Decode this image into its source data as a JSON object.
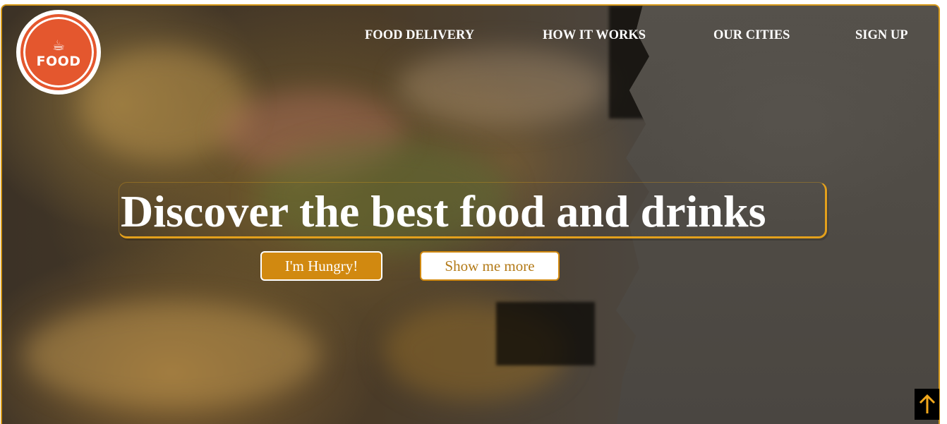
{
  "brand": {
    "logo_text": "FOOD",
    "logo_icon": "bowl-icon",
    "logo_color": "#e4572e"
  },
  "nav": {
    "items": [
      {
        "label": "FOOD DELIVERY"
      },
      {
        "label": "HOW IT WORKS"
      },
      {
        "label": "OUR CITIES"
      },
      {
        "label": "SIGN UP"
      }
    ]
  },
  "hero": {
    "title": "Discover the best food and drinks",
    "primary_button": "I'm Hungry!",
    "secondary_button": "Show me more"
  },
  "scroll_top": {
    "icon": "arrow-up-icon"
  },
  "colors": {
    "accent": "#d18910",
    "accent_border": "#e3a01c",
    "nav_text": "#ffffff",
    "scroll_button_bg": "#000000"
  }
}
